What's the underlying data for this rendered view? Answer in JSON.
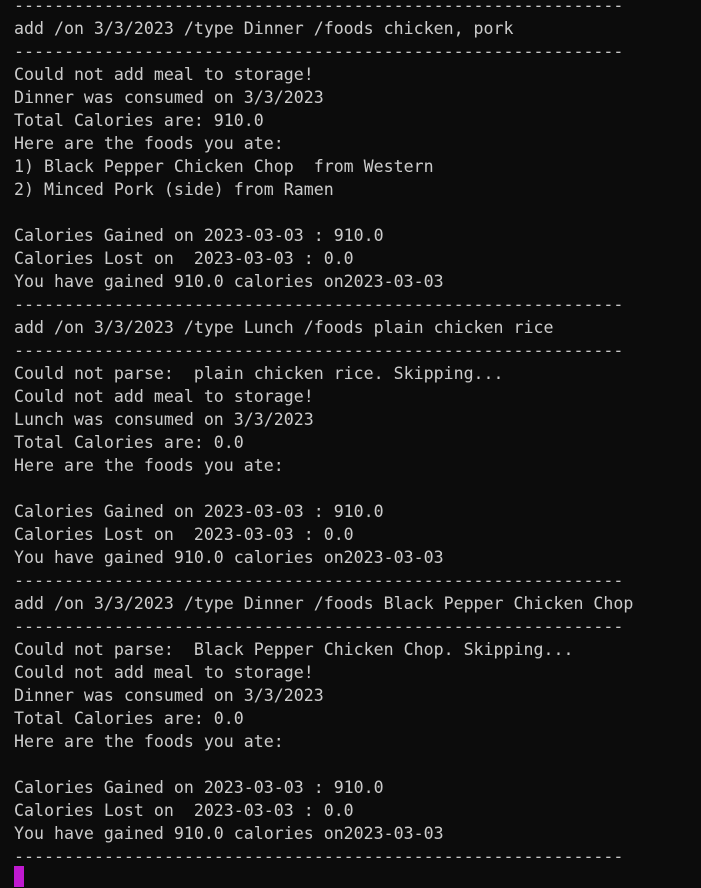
{
  "terminal": {
    "lines": [
      "-------------------------------------------------------------",
      "add /on 3/3/2023 /type Dinner /foods chicken, pork",
      "-------------------------------------------------------------",
      "Could not add meal to storage!",
      "Dinner was consumed on 3/3/2023",
      "Total Calories are: 910.0",
      "Here are the foods you ate:",
      "1) Black Pepper Chicken Chop  from Western",
      "2) Minced Pork (side) from Ramen",
      "",
      "Calories Gained on 2023-03-03 : 910.0",
      "Calories Lost on  2023-03-03 : 0.0",
      "You have gained 910.0 calories on2023-03-03",
      "-------------------------------------------------------------",
      "add /on 3/3/2023 /type Lunch /foods plain chicken rice",
      "-------------------------------------------------------------",
      "Could not parse:  plain chicken rice. Skipping...",
      "Could not add meal to storage!",
      "Lunch was consumed on 3/3/2023",
      "Total Calories are: 0.0",
      "Here are the foods you ate:",
      "",
      "Calories Gained on 2023-03-03 : 910.0",
      "Calories Lost on  2023-03-03 : 0.0",
      "You have gained 910.0 calories on2023-03-03",
      "-------------------------------------------------------------",
      "add /on 3/3/2023 /type Dinner /foods Black Pepper Chicken Chop",
      "-------------------------------------------------------------",
      "Could not parse:  Black Pepper Chicken Chop. Skipping...",
      "Could not add meal to storage!",
      "Dinner was consumed on 3/3/2023",
      "Total Calories are: 0.0",
      "Here are the foods you ate:",
      "",
      "Calories Gained on 2023-03-03 : 910.0",
      "Calories Lost on  2023-03-03 : 0.0",
      "You have gained 910.0 calories on2023-03-03",
      "-------------------------------------------------------------"
    ],
    "cursor_color": "#c01ad0",
    "background_color": "#0c0c0c",
    "text_color": "#cccccc"
  }
}
